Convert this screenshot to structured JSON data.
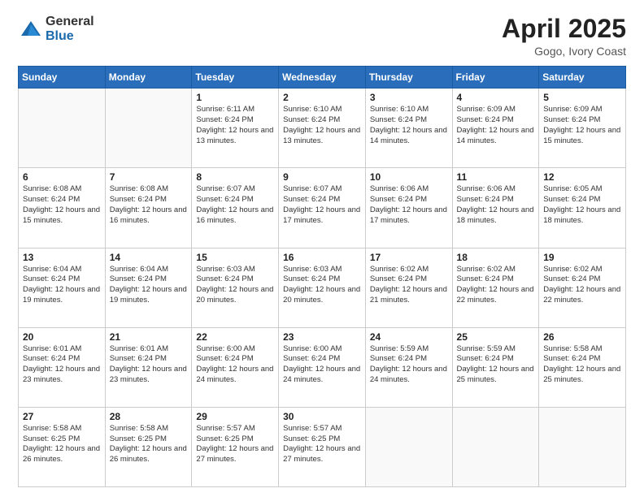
{
  "logo": {
    "general": "General",
    "blue": "Blue"
  },
  "title": {
    "month": "April 2025",
    "location": "Gogo, Ivory Coast"
  },
  "weekdays": [
    "Sunday",
    "Monday",
    "Tuesday",
    "Wednesday",
    "Thursday",
    "Friday",
    "Saturday"
  ],
  "weeks": [
    [
      {
        "day": "",
        "sunrise": "",
        "sunset": "",
        "daylight": ""
      },
      {
        "day": "",
        "sunrise": "",
        "sunset": "",
        "daylight": ""
      },
      {
        "day": "1",
        "sunrise": "Sunrise: 6:11 AM",
        "sunset": "Sunset: 6:24 PM",
        "daylight": "Daylight: 12 hours and 13 minutes."
      },
      {
        "day": "2",
        "sunrise": "Sunrise: 6:10 AM",
        "sunset": "Sunset: 6:24 PM",
        "daylight": "Daylight: 12 hours and 13 minutes."
      },
      {
        "day": "3",
        "sunrise": "Sunrise: 6:10 AM",
        "sunset": "Sunset: 6:24 PM",
        "daylight": "Daylight: 12 hours and 14 minutes."
      },
      {
        "day": "4",
        "sunrise": "Sunrise: 6:09 AM",
        "sunset": "Sunset: 6:24 PM",
        "daylight": "Daylight: 12 hours and 14 minutes."
      },
      {
        "day": "5",
        "sunrise": "Sunrise: 6:09 AM",
        "sunset": "Sunset: 6:24 PM",
        "daylight": "Daylight: 12 hours and 15 minutes."
      }
    ],
    [
      {
        "day": "6",
        "sunrise": "Sunrise: 6:08 AM",
        "sunset": "Sunset: 6:24 PM",
        "daylight": "Daylight: 12 hours and 15 minutes."
      },
      {
        "day": "7",
        "sunrise": "Sunrise: 6:08 AM",
        "sunset": "Sunset: 6:24 PM",
        "daylight": "Daylight: 12 hours and 16 minutes."
      },
      {
        "day": "8",
        "sunrise": "Sunrise: 6:07 AM",
        "sunset": "Sunset: 6:24 PM",
        "daylight": "Daylight: 12 hours and 16 minutes."
      },
      {
        "day": "9",
        "sunrise": "Sunrise: 6:07 AM",
        "sunset": "Sunset: 6:24 PM",
        "daylight": "Daylight: 12 hours and 17 minutes."
      },
      {
        "day": "10",
        "sunrise": "Sunrise: 6:06 AM",
        "sunset": "Sunset: 6:24 PM",
        "daylight": "Daylight: 12 hours and 17 minutes."
      },
      {
        "day": "11",
        "sunrise": "Sunrise: 6:06 AM",
        "sunset": "Sunset: 6:24 PM",
        "daylight": "Daylight: 12 hours and 18 minutes."
      },
      {
        "day": "12",
        "sunrise": "Sunrise: 6:05 AM",
        "sunset": "Sunset: 6:24 PM",
        "daylight": "Daylight: 12 hours and 18 minutes."
      }
    ],
    [
      {
        "day": "13",
        "sunrise": "Sunrise: 6:04 AM",
        "sunset": "Sunset: 6:24 PM",
        "daylight": "Daylight: 12 hours and 19 minutes."
      },
      {
        "day": "14",
        "sunrise": "Sunrise: 6:04 AM",
        "sunset": "Sunset: 6:24 PM",
        "daylight": "Daylight: 12 hours and 19 minutes."
      },
      {
        "day": "15",
        "sunrise": "Sunrise: 6:03 AM",
        "sunset": "Sunset: 6:24 PM",
        "daylight": "Daylight: 12 hours and 20 minutes."
      },
      {
        "day": "16",
        "sunrise": "Sunrise: 6:03 AM",
        "sunset": "Sunset: 6:24 PM",
        "daylight": "Daylight: 12 hours and 20 minutes."
      },
      {
        "day": "17",
        "sunrise": "Sunrise: 6:02 AM",
        "sunset": "Sunset: 6:24 PM",
        "daylight": "Daylight: 12 hours and 21 minutes."
      },
      {
        "day": "18",
        "sunrise": "Sunrise: 6:02 AM",
        "sunset": "Sunset: 6:24 PM",
        "daylight": "Daylight: 12 hours and 22 minutes."
      },
      {
        "day": "19",
        "sunrise": "Sunrise: 6:02 AM",
        "sunset": "Sunset: 6:24 PM",
        "daylight": "Daylight: 12 hours and 22 minutes."
      }
    ],
    [
      {
        "day": "20",
        "sunrise": "Sunrise: 6:01 AM",
        "sunset": "Sunset: 6:24 PM",
        "daylight": "Daylight: 12 hours and 23 minutes."
      },
      {
        "day": "21",
        "sunrise": "Sunrise: 6:01 AM",
        "sunset": "Sunset: 6:24 PM",
        "daylight": "Daylight: 12 hours and 23 minutes."
      },
      {
        "day": "22",
        "sunrise": "Sunrise: 6:00 AM",
        "sunset": "Sunset: 6:24 PM",
        "daylight": "Daylight: 12 hours and 24 minutes."
      },
      {
        "day": "23",
        "sunrise": "Sunrise: 6:00 AM",
        "sunset": "Sunset: 6:24 PM",
        "daylight": "Daylight: 12 hours and 24 minutes."
      },
      {
        "day": "24",
        "sunrise": "Sunrise: 5:59 AM",
        "sunset": "Sunset: 6:24 PM",
        "daylight": "Daylight: 12 hours and 24 minutes."
      },
      {
        "day": "25",
        "sunrise": "Sunrise: 5:59 AM",
        "sunset": "Sunset: 6:24 PM",
        "daylight": "Daylight: 12 hours and 25 minutes."
      },
      {
        "day": "26",
        "sunrise": "Sunrise: 5:58 AM",
        "sunset": "Sunset: 6:24 PM",
        "daylight": "Daylight: 12 hours and 25 minutes."
      }
    ],
    [
      {
        "day": "27",
        "sunrise": "Sunrise: 5:58 AM",
        "sunset": "Sunset: 6:25 PM",
        "daylight": "Daylight: 12 hours and 26 minutes."
      },
      {
        "day": "28",
        "sunrise": "Sunrise: 5:58 AM",
        "sunset": "Sunset: 6:25 PM",
        "daylight": "Daylight: 12 hours and 26 minutes."
      },
      {
        "day": "29",
        "sunrise": "Sunrise: 5:57 AM",
        "sunset": "Sunset: 6:25 PM",
        "daylight": "Daylight: 12 hours and 27 minutes."
      },
      {
        "day": "30",
        "sunrise": "Sunrise: 5:57 AM",
        "sunset": "Sunset: 6:25 PM",
        "daylight": "Daylight: 12 hours and 27 minutes."
      },
      {
        "day": "",
        "sunrise": "",
        "sunset": "",
        "daylight": ""
      },
      {
        "day": "",
        "sunrise": "",
        "sunset": "",
        "daylight": ""
      },
      {
        "day": "",
        "sunrise": "",
        "sunset": "",
        "daylight": ""
      }
    ]
  ]
}
